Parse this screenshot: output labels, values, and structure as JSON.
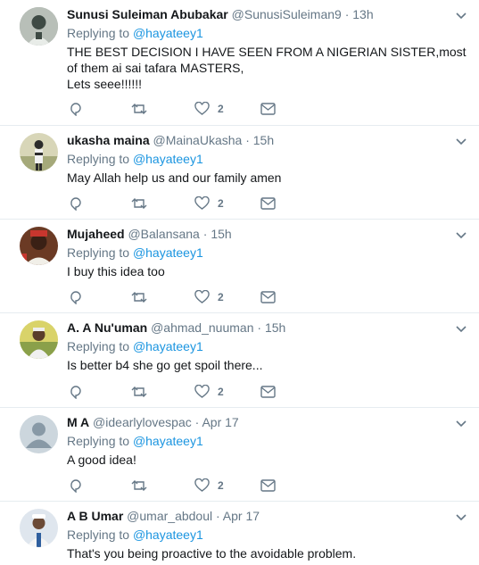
{
  "replying_label": "Replying to",
  "tweets": [
    {
      "name": "Sunusi Suleiman Abubakar",
      "handle": "@SunusiSuleiman9",
      "time": "13h",
      "reply_to": "@hayateey1",
      "text_lines": [
        "THE BEST DECISION I HAVE SEEN FROM A NIGERIAN SISTER,most of them ai sai tafara MASTERS,",
        "Lets seee!!!!!!"
      ],
      "likes": "2",
      "avatar_colors": {
        "bg": "#9aa39a",
        "fg": "#3e4a44"
      }
    },
    {
      "name": "ukasha maina",
      "handle": "@MainaUkasha",
      "time": "15h",
      "reply_to": "@hayateey1",
      "text_lines": [
        "May Allah help us and our family amen"
      ],
      "likes": "2",
      "avatar_colors": {
        "bg": "#c7c4a7",
        "fg": "#2b2b2b"
      }
    },
    {
      "name": "Mujaheed",
      "handle": "@Balansana",
      "time": "15h",
      "reply_to": "@hayateey1",
      "text_lines": [
        "I buy this idea too"
      ],
      "likes": "2",
      "avatar_colors": {
        "bg": "#6b3a24",
        "fg": "#c8362e"
      }
    },
    {
      "name": "A. A Nu'uman",
      "handle": "@ahmad_nuuman",
      "time": "15h",
      "reply_to": "@hayateey1",
      "text_lines": [
        "Is better b4 she go get spoil there..."
      ],
      "likes": "2",
      "avatar_colors": {
        "bg": "#d9d36a",
        "fg": "#5a3e2b"
      }
    },
    {
      "name": "M A",
      "handle": "@idearlylovespac",
      "time": "Apr 17",
      "reply_to": "@hayateey1",
      "text_lines": [
        "A good idea!"
      ],
      "likes": "2",
      "avatar_colors": {
        "bg": "#ccd6dd",
        "fg": "#8899a6"
      }
    },
    {
      "name": "A B Umar",
      "handle": "@umar_abdoul",
      "time": "Apr 17",
      "reply_to": "@hayateey1",
      "text_lines": [
        "That's you being proactive to the avoidable problem."
      ],
      "likes": "",
      "avatar_colors": {
        "bg": "#dfe6ee",
        "fg": "#2f5f9e"
      }
    }
  ],
  "colors": {
    "link": "#1b95e0",
    "muted": "#657786",
    "divider": "#e6ecf0"
  }
}
